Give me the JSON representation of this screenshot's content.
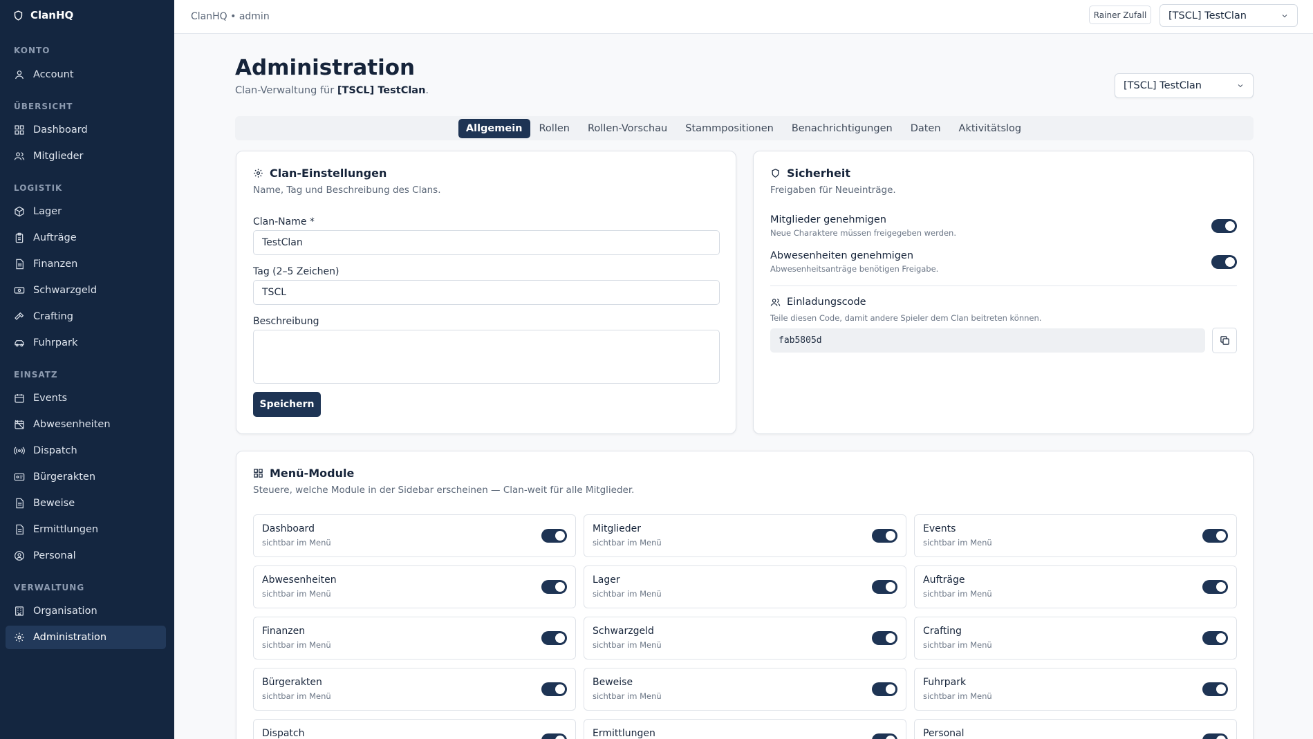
{
  "app": {
    "name": "ClanHQ",
    "breadcrumb": "ClanHQ • admin",
    "user": "Rainer Zufall",
    "clan_select": "[TSCL] TestClan"
  },
  "sidebar": {
    "sections": [
      {
        "label": "KONTO",
        "items": [
          {
            "label": "Account",
            "icon": "user-icon"
          }
        ]
      },
      {
        "label": "ÜBERSICHT",
        "items": [
          {
            "label": "Dashboard",
            "icon": "grid-icon"
          },
          {
            "label": "Mitglieder",
            "icon": "users-icon"
          }
        ]
      },
      {
        "label": "LOGISTIK",
        "items": [
          {
            "label": "Lager",
            "icon": "box-icon"
          },
          {
            "label": "Aufträge",
            "icon": "clipboard-icon"
          },
          {
            "label": "Finanzen",
            "icon": "file-icon"
          },
          {
            "label": "Schwarzgeld",
            "icon": "cash-icon"
          },
          {
            "label": "Crafting",
            "icon": "hammer-icon"
          },
          {
            "label": "Fuhrpark",
            "icon": "car-icon"
          }
        ]
      },
      {
        "label": "EINSATZ",
        "items": [
          {
            "label": "Events",
            "icon": "calendar-icon"
          },
          {
            "label": "Abwesenheiten",
            "icon": "calendar-off-icon"
          },
          {
            "label": "Dispatch",
            "icon": "radio-icon"
          },
          {
            "label": "Bürgerakten",
            "icon": "id-card-icon"
          },
          {
            "label": "Beweise",
            "icon": "file-icon"
          },
          {
            "label": "Ermittlungen",
            "icon": "file-icon"
          },
          {
            "label": "Personal",
            "icon": "user-circle-icon"
          }
        ]
      },
      {
        "label": "VERWALTUNG",
        "items": [
          {
            "label": "Organisation",
            "icon": "building-icon"
          },
          {
            "label": "Administration",
            "icon": "gear-icon",
            "active": true
          }
        ]
      }
    ]
  },
  "page": {
    "title": "Administration",
    "subtitle_prefix": "Clan-Verwaltung für ",
    "subtitle_clan": "[TSCL] TestClan",
    "subtitle_suffix": ".",
    "clan_select": "[TSCL] TestClan"
  },
  "tabs": [
    {
      "label": "Allgemein",
      "active": true
    },
    {
      "label": "Rollen"
    },
    {
      "label": "Rollen-Vorschau"
    },
    {
      "label": "Stammpositionen"
    },
    {
      "label": "Benachrichtigungen"
    },
    {
      "label": "Daten"
    },
    {
      "label": "Aktivitätslog"
    }
  ],
  "clan_settings": {
    "title": "Clan-Einstellungen",
    "desc": "Name, Tag und Beschreibung des Clans.",
    "name_label": "Clan-Name *",
    "name_value": "TestClan",
    "tag_label": "Tag (2–5 Zeichen)",
    "tag_value": "TSCL",
    "desc_label": "Beschreibung",
    "desc_value": "",
    "save": "Speichern"
  },
  "security": {
    "title": "Sicherheit",
    "desc": "Freigaben für Neueinträge.",
    "settings": [
      {
        "title": "Mitglieder genehmigen",
        "sub": "Neue Charaktere müssen freigegeben werden.",
        "on": true
      },
      {
        "title": "Abwesenheiten genehmigen",
        "sub": "Abwesenheitsanträge benötigen Freigabe.",
        "on": true
      }
    ],
    "invite_title": "Einladungscode",
    "invite_desc": "Teile diesen Code, damit andere Spieler dem Clan beitreten können.",
    "invite_code": "fab5805d"
  },
  "modules": {
    "title": "Menü-Module",
    "desc": "Steuere, welche Module in der Sidebar erscheinen — Clan-weit für alle Mitglieder.",
    "items": [
      {
        "name": "Dashboard",
        "sub": "sichtbar im Menü",
        "on": true
      },
      {
        "name": "Mitglieder",
        "sub": "sichtbar im Menü",
        "on": true
      },
      {
        "name": "Events",
        "sub": "sichtbar im Menü",
        "on": true
      },
      {
        "name": "Abwesenheiten",
        "sub": "sichtbar im Menü",
        "on": true
      },
      {
        "name": "Lager",
        "sub": "sichtbar im Menü",
        "on": true
      },
      {
        "name": "Aufträge",
        "sub": "sichtbar im Menü",
        "on": true
      },
      {
        "name": "Finanzen",
        "sub": "sichtbar im Menü",
        "on": true
      },
      {
        "name": "Schwarzgeld",
        "sub": "sichtbar im Menü",
        "on": true
      },
      {
        "name": "Crafting",
        "sub": "sichtbar im Menü",
        "on": true
      },
      {
        "name": "Bürgerakten",
        "sub": "sichtbar im Menü",
        "on": true
      },
      {
        "name": "Beweise",
        "sub": "sichtbar im Menü",
        "on": true
      },
      {
        "name": "Fuhrpark",
        "sub": "sichtbar im Menü",
        "on": true
      },
      {
        "name": "Dispatch",
        "sub": "",
        "on": true
      },
      {
        "name": "Ermittlungen",
        "sub": "",
        "on": true
      },
      {
        "name": "Personal",
        "sub": "",
        "on": true
      }
    ]
  }
}
